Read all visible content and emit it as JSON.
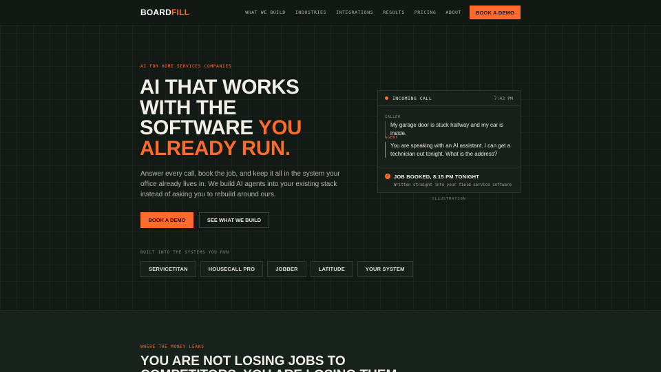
{
  "brand": {
    "logo_part1": "BOARD",
    "logo_part2": "FILL",
    "accent_color": "#ff6b2c"
  },
  "nav": {
    "links": [
      "WHAT WE BUILD",
      "INDUSTRIES",
      "INTEGRATIONS",
      "RESULTS",
      "PRICING",
      "ABOUT"
    ],
    "cta": "BOOK A DEMO"
  },
  "hero": {
    "eyebrow": "AI FOR HOME SERVICES COMPANIES",
    "headline_line1": "AI THAT WORKS",
    "headline_line2": "WITH THE",
    "headline_line3a": "SOFTWARE ",
    "headline_line3b": "YOU",
    "headline_line4": "ALREADY RUN.",
    "description": "Answer every call, book the job, and keep it all in the system your office already lives in. We build AI agents into your existing stack instead of asking you to rebuild around ours.",
    "primary_cta": "BOOK A DEMO",
    "secondary_cta": "SEE WHAT WE BUILD",
    "integrations_label": "BUILT INTO THE SYSTEMS YOU RUN",
    "integrations": [
      "SERVICETITAN",
      "HOUSECALL PRO",
      "JOBBER",
      "LATITUDE",
      "YOUR SYSTEM"
    ]
  },
  "call_card": {
    "title": "INCOMING CALL",
    "time": "7:42 PM",
    "caller_label": "CALLER",
    "caller_text": "My garage door is stuck halfway and my car is inside.",
    "agent_label": "AGENT",
    "agent_text": "You are speaking with an AI assistant. I can get a technician out tonight. What is the address?",
    "booked_text": "JOB BOOKED, 8:15 PM TONIGHT",
    "booked_sub": "Written straight into your field service software",
    "caption": "ILLUSTRATION"
  },
  "section2": {
    "eyebrow": "WHERE THE MONEY LEAKS",
    "headline": "YOU ARE NOT LOSING JOBS TO COMPETITORS. YOU ARE LOSING THEM"
  }
}
